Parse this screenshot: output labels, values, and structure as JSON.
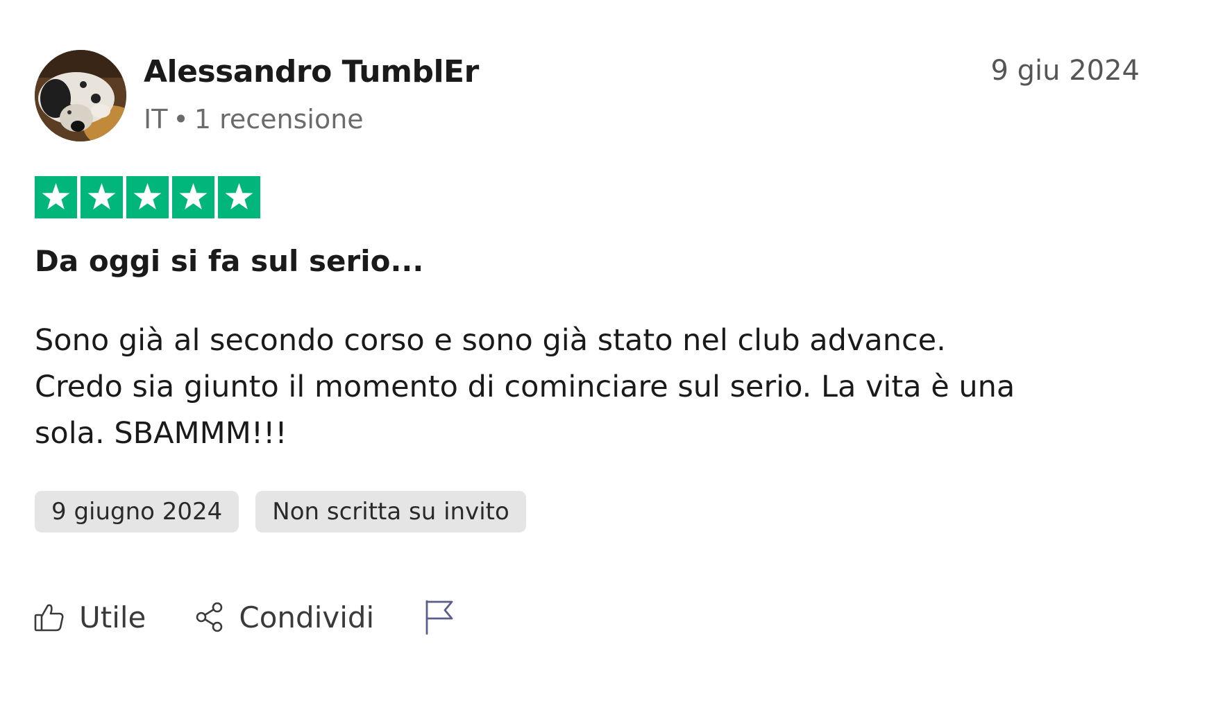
{
  "reviewer": {
    "name": "Alessandro TumblEr",
    "country": "IT",
    "separator": "•",
    "review_count": "1 recensione"
  },
  "review": {
    "date_short": "9 giu 2024",
    "rating": 5,
    "rating_max": 5,
    "star_color": "#00b67a",
    "title": "Da oggi si fa sul serio...",
    "body_lines": [
      "Sono già al secondo corso e sono già stato nel club advance.",
      "Credo sia giunto il momento di cominciare sul serio. La vita è una",
      "sola. SBAMMM!!!"
    ]
  },
  "chips": {
    "experience_date": "9 giugno 2024",
    "invite_status": "Non scritta su invito"
  },
  "actions": {
    "helpful_label": "Utile",
    "share_label": "Condividi",
    "helpful_icon": "thumbs-up-icon",
    "share_icon": "share-icon",
    "flag_icon": "flag-icon"
  }
}
